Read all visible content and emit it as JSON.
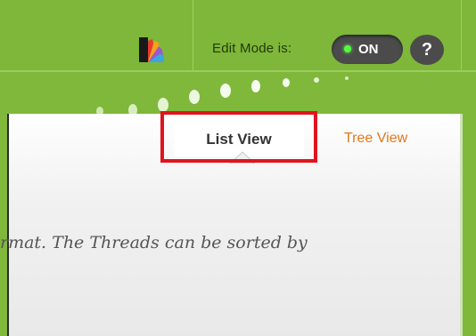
{
  "header": {
    "edit_mode_label": "Edit Mode is:",
    "toggle_state": "ON",
    "help_label": "?",
    "palette_icon": "color-palette-icon",
    "colors": {
      "bar": "#7eb739",
      "toggle": "#4b4b4b",
      "indicator": "#4eff3a"
    }
  },
  "tabs": {
    "list_view": "List View",
    "tree_view": "Tree View",
    "active": "List View",
    "highlight_color": "#e0141e"
  },
  "content": {
    "text": "rmat. The Threads can be sorted by"
  }
}
